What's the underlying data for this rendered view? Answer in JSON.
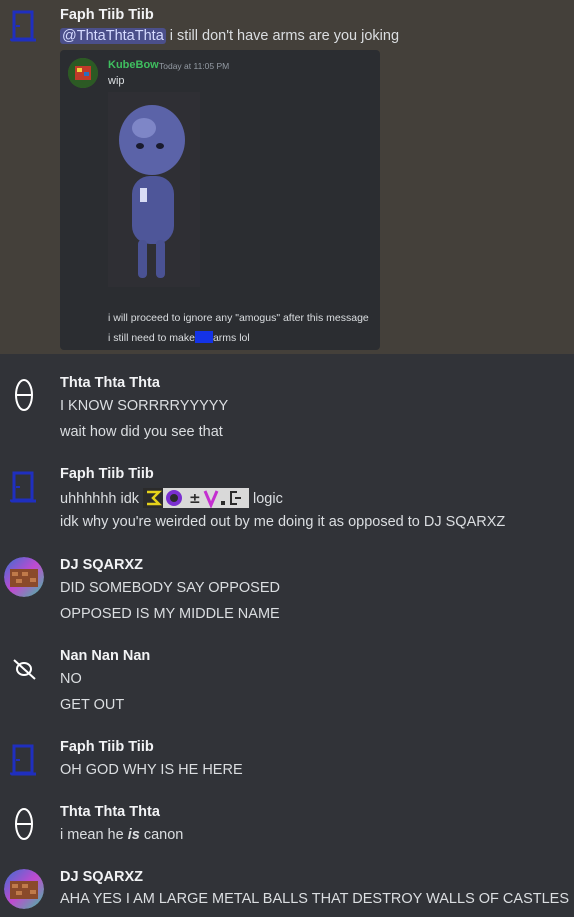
{
  "messages": [
    {
      "author": "Faph Tiib Tiib",
      "mention": "@ThtaThtaThta",
      "text": " i still don't have arms are you joking"
    },
    {
      "author": "Thta Thta Thta",
      "lines": [
        "I KNOW SORRRRYYYYY",
        "wait how did you see that"
      ]
    },
    {
      "author": "Faph Tiib Tiib",
      "line1_pre": "uhhhhhh idk",
      "line1_post": "logic",
      "line2": "idk why you're weirded out by me doing it as opposed to DJ SQARXZ"
    },
    {
      "author": "DJ SQARXZ",
      "lines": [
        "DID SOMEBODY SAY OPPOSED",
        "OPPOSED IS MY MIDDLE NAME"
      ]
    },
    {
      "author": "Nan Nan Nan",
      "lines": [
        "NO",
        "GET OUT"
      ]
    },
    {
      "author": "Faph Tiib Tiib",
      "lines": [
        "OH GOD WHY IS HE HERE"
      ]
    },
    {
      "author": "Thta Thta Thta",
      "pre": "i mean he ",
      "em": "is",
      "post": " canon"
    },
    {
      "author": "DJ SQARXZ",
      "lines": [
        "AHA YES I AM LARGE METAL BALLS THAT DESTROY WALLS OF CASTLES"
      ]
    }
  ],
  "embed": {
    "author": "KubeBow",
    "time": "Today at 11:05 PM",
    "text": "wip",
    "line1": "i will proceed to ignore any \"amogus\" after this message",
    "line2_pre": "i still need to make",
    "line2_post": "arms lol"
  },
  "colors": {
    "background": "#313338",
    "highlight": "#44403a",
    "mention": "#4b4f8a",
    "embed_author": "#3fbf5f"
  }
}
